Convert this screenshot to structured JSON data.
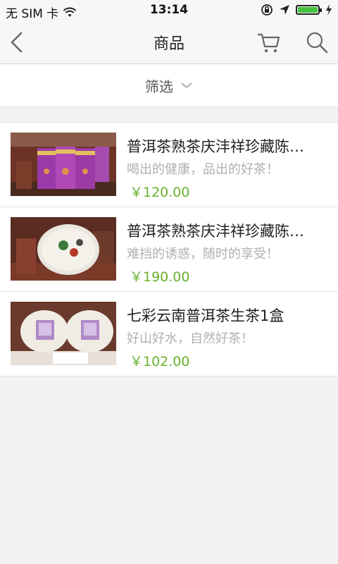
{
  "status": {
    "carrier": "无 SIM 卡",
    "time": "13:14"
  },
  "nav": {
    "title": "商品",
    "icons": [
      "back-icon",
      "cart-icon",
      "search-icon"
    ]
  },
  "filter": {
    "label": "筛选"
  },
  "products": [
    {
      "title": "普洱茶熟茶庆沣祥珍藏陈…",
      "subtitle": "喝出的健康，品出的好茶！",
      "price": "￥120.00"
    },
    {
      "title": "普洱茶熟茶庆沣祥珍藏陈…",
      "subtitle": "难挡的诱惑，随时的享受！",
      "price": "￥190.00"
    },
    {
      "title": "七彩云南普洱茶生茶1盒",
      "subtitle": "好山好水，自然好茶！",
      "price": "￥102.00"
    }
  ],
  "colors": {
    "price": "#6ab02d",
    "battery": "#43c23e"
  }
}
